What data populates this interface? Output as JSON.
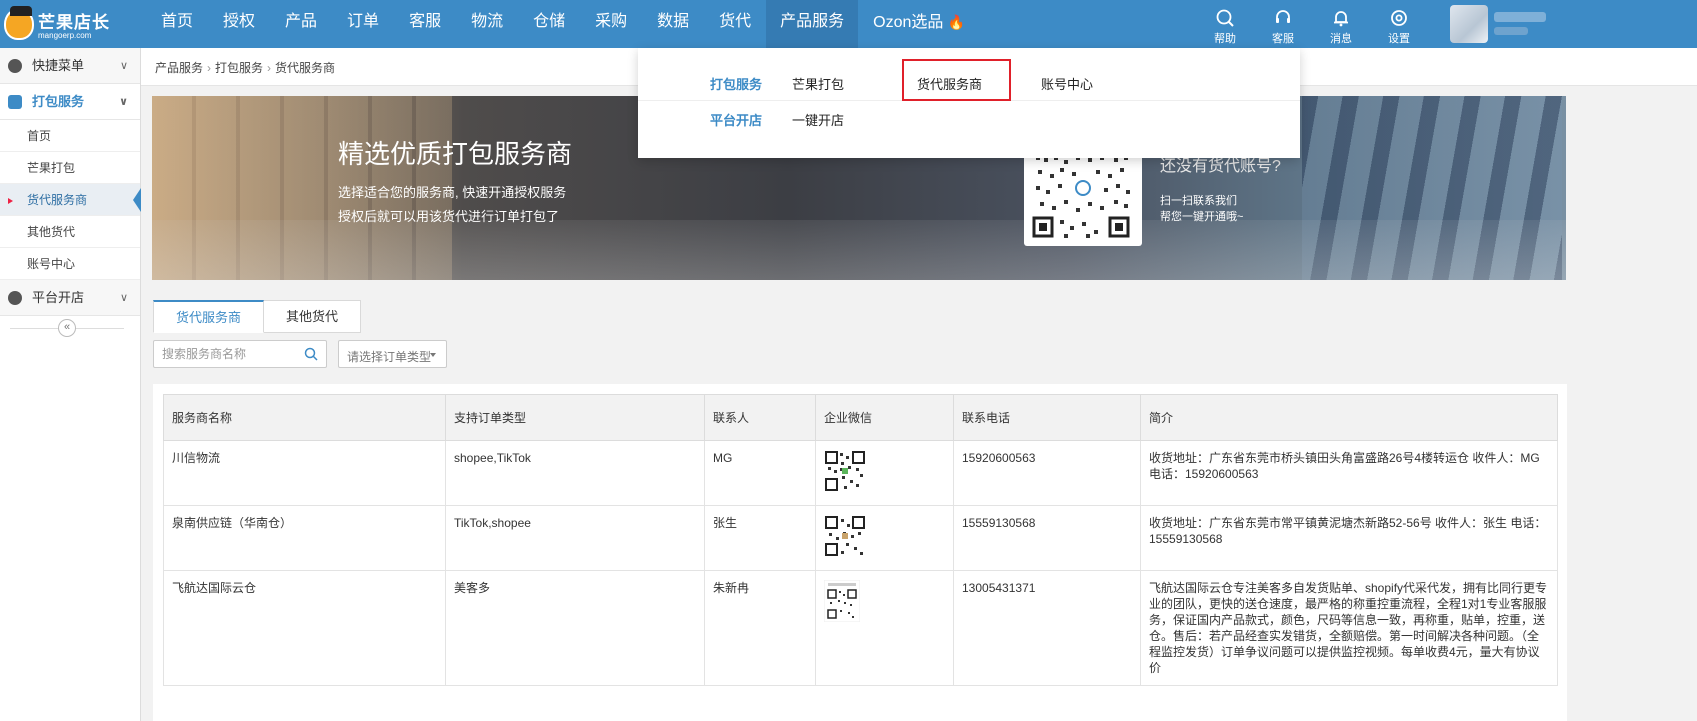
{
  "logo": {
    "name": "芒果店长",
    "sub": "mangoerp.com"
  },
  "nav": {
    "items": [
      "首页",
      "授权",
      "产品",
      "订单",
      "客服",
      "物流",
      "仓储",
      "采购",
      "数据",
      "货代",
      "产品服务"
    ],
    "ozon": "Ozon选品"
  },
  "tools": [
    {
      "label": "帮助",
      "icon": "help-icon"
    },
    {
      "label": "客服",
      "icon": "headset-icon"
    },
    {
      "label": "消息",
      "icon": "bell-icon"
    },
    {
      "label": "设置",
      "icon": "gear-icon"
    }
  ],
  "sidebar": {
    "quick": "快捷菜单",
    "pack": "打包服务",
    "items": [
      "首页",
      "芒果打包",
      "货代服务商",
      "其他货代",
      "账号中心"
    ],
    "platform": "平台开店"
  },
  "breadcrumb": [
    "产品服务",
    "打包服务",
    "货代服务商"
  ],
  "banner": {
    "title": "精选优质打包服务商",
    "line1": "选择适合您的服务商, 快速开通授权服务",
    "line2": "授权后就可以用该货代进行订单打包了",
    "side_title": "还没有货代账号?",
    "side_line1": "扫一扫联系我们",
    "side_line2": "帮您一键开通哦~"
  },
  "dropdown": {
    "row1": {
      "category": "打包服务",
      "links": [
        "芒果打包",
        "货代服务商",
        "账号中心"
      ]
    },
    "row2": {
      "category": "平台开店",
      "links": [
        "一键开店"
      ]
    }
  },
  "tabs": [
    "货代服务商",
    "其他货代"
  ],
  "search": {
    "placeholder": "搜索服务商名称"
  },
  "order_type": {
    "placeholder": "请选择订单类型"
  },
  "table": {
    "headers": [
      "服务商名称",
      "支持订单类型",
      "联系人",
      "企业微信",
      "联系电话",
      "简介"
    ],
    "rows": [
      {
        "name": "川信物流",
        "types": "shopee,TikTok",
        "contact": "MG",
        "phone": "15920600563",
        "intro": "收货地址：广东省东莞市桥头镇田头角富盛路26号4楼转运仓 收件人：MG 电话：15920600563"
      },
      {
        "name": "泉南供应链（华南仓）",
        "types": "TikTok,shopee",
        "contact": "张生",
        "phone": "15559130568",
        "intro": "收货地址：广东省东莞市常平镇黄泥塘杰新路52-56号 收件人：张生 电话：15559130568"
      },
      {
        "name": "飞航达国际云仓",
        "types": "美客多",
        "contact": "朱新冉",
        "phone": "13005431371",
        "intro": "飞航达国际云仓专注美客多自发货贴单、shopify代采代发，拥有比同行更专业的团队，更快的送仓速度，最严格的称重控重流程，全程1对1专业客服服务，保证国内产品款式，颜色，尺码等信息一致，再称重，贴单，控重，送仓。售后：若产品经查实发错货，全额赔偿。第一时间解决各种问题。（全程监控发货）订单争议问题可以提供监控视频。每单收费4元，量大有协议价"
      }
    ]
  },
  "colors": {
    "primary": "#3d8bc6",
    "highlight": "#e0202a"
  }
}
